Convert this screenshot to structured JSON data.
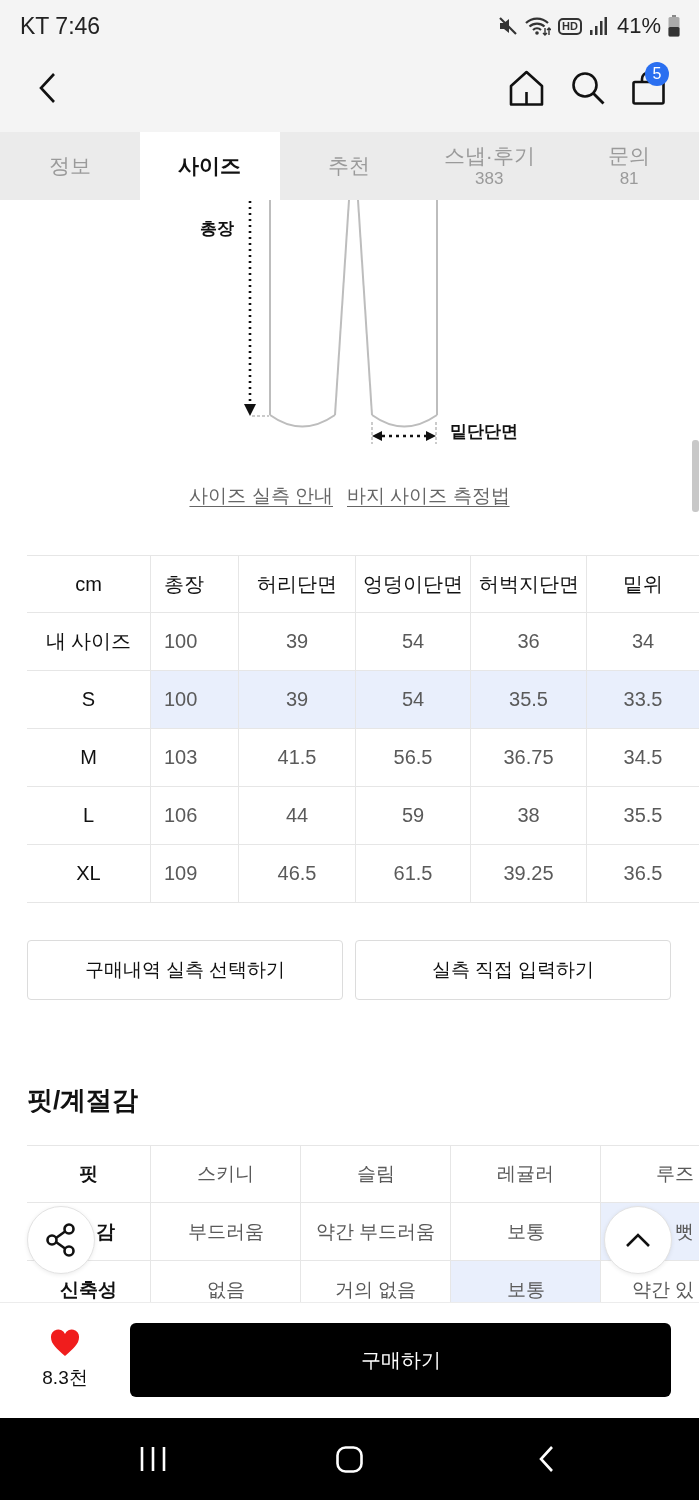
{
  "status_bar": {
    "time": "KT 7:46",
    "network_badge": "HD",
    "battery": "41%"
  },
  "header": {
    "cart_count": "5"
  },
  "tabs": [
    {
      "label": "정보",
      "selected": false
    },
    {
      "label": "사이즈",
      "selected": true
    },
    {
      "label": "추천",
      "selected": false
    },
    {
      "label": "스냅·후기",
      "count": "383",
      "selected": false
    },
    {
      "label": "문의",
      "count": "81",
      "selected": false
    }
  ],
  "diagram": {
    "length_label": "총장",
    "hem_label": "밑단단면"
  },
  "guide_links": [
    "사이즈 실측 안내",
    "바지 사이즈 측정법"
  ],
  "size_table": {
    "columns": [
      "cm",
      "총장",
      "허리단면",
      "엉덩이단면",
      "허벅지단면",
      "밑위"
    ],
    "rows": [
      {
        "size": "내 사이즈",
        "values": [
          "100",
          "39",
          "54",
          "36",
          "34"
        ],
        "selected": false
      },
      {
        "size": "S",
        "values": [
          "100",
          "39",
          "54",
          "35.5",
          "33.5"
        ],
        "selected": true
      },
      {
        "size": "M",
        "values": [
          "103",
          "41.5",
          "56.5",
          "36.75",
          "34.5"
        ],
        "selected": false
      },
      {
        "size": "L",
        "values": [
          "106",
          "44",
          "59",
          "38",
          "35.5"
        ],
        "selected": false
      },
      {
        "size": "XL",
        "values": [
          "109",
          "46.5",
          "61.5",
          "39.25",
          "36.5"
        ],
        "selected": false
      }
    ]
  },
  "measure_buttons": [
    "구매내역 실측 선택하기",
    "실측 직접 입력하기"
  ],
  "fit_section": {
    "title": "핏/계절감",
    "rows": [
      {
        "label": "핏",
        "options": [
          {
            "text": "스키니",
            "selected": false
          },
          {
            "text": "슬림",
            "selected": false
          },
          {
            "text": "레귤러",
            "selected": false
          },
          {
            "text": "루즈",
            "selected": false
          }
        ]
      },
      {
        "label": "감",
        "options": [
          {
            "text": "부드러움",
            "selected": false
          },
          {
            "text": "약간 부드러움",
            "selected": false
          },
          {
            "text": "보통",
            "selected": false
          },
          {
            "text": "뻣",
            "selected": true
          }
        ]
      },
      {
        "label": "신축성",
        "options": [
          {
            "text": "없음",
            "selected": false
          },
          {
            "text": "거의 없음",
            "selected": false
          },
          {
            "text": "보통",
            "selected": true
          },
          {
            "text": "약간 있",
            "selected": false
          }
        ]
      }
    ]
  },
  "bottom_bar": {
    "liked": true,
    "likes": "8.3천",
    "buy_label": "구매하기"
  }
}
